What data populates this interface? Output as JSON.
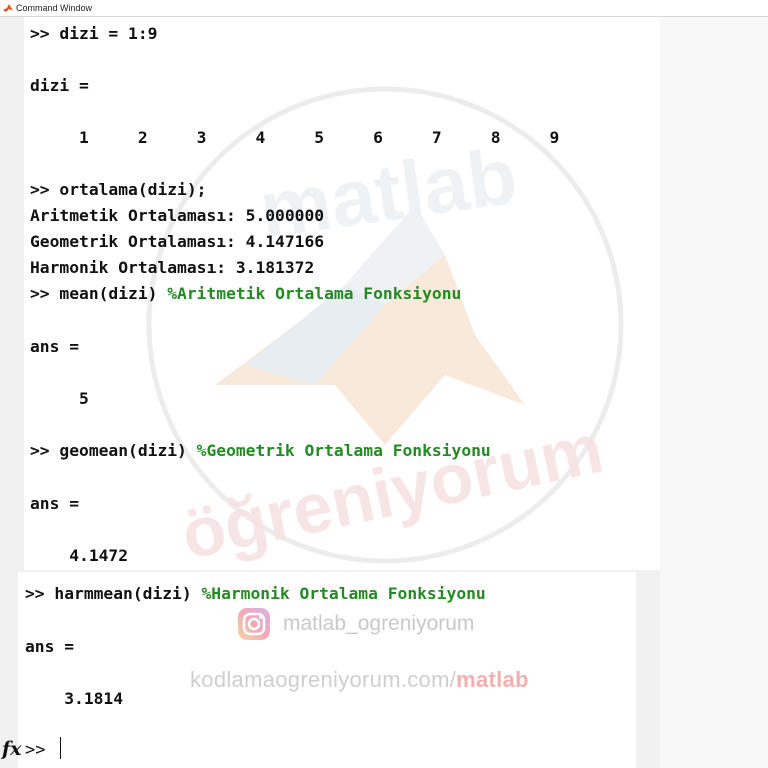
{
  "window": {
    "title": "Command Window"
  },
  "console": {
    "lines": [
      {
        "id": "cmd1",
        "prompt": ">> ",
        "code": "dizi = 1:9",
        "comment": ""
      },
      {
        "id": "out1",
        "text": "dizi ="
      },
      {
        "id": "out2",
        "text": "     1     2     3     4     5     6     7     8     9"
      },
      {
        "id": "cmd2",
        "prompt": ">> ",
        "code": "ortalama(dizi);",
        "comment": ""
      },
      {
        "id": "out3",
        "text": "Aritmetik Ortalaması: 5.000000"
      },
      {
        "id": "out4",
        "text": "Geometrik Ortalaması: 4.147166"
      },
      {
        "id": "out5",
        "text": "Harmonik Ortalaması: 3.181372"
      },
      {
        "id": "cmd3",
        "prompt": ">> ",
        "code": "mean(dizi) ",
        "comment": "%Aritmetik Ortalama Fonksiyonu"
      },
      {
        "id": "out6",
        "text": "ans ="
      },
      {
        "id": "out7",
        "text": "     5"
      },
      {
        "id": "cmd4",
        "prompt": ">> ",
        "code": "geomean(dizi) ",
        "comment": "%Geometrik Ortalama Fonksiyonu"
      },
      {
        "id": "out8",
        "text": "ans ="
      },
      {
        "id": "out9",
        "text": "    4.1472"
      },
      {
        "id": "cmd5",
        "prompt": ">> ",
        "code": "harmmean(dizi) ",
        "comment": "%Harmonik Ortalama Fonksiyonu"
      },
      {
        "id": "out10",
        "text": "ans ="
      },
      {
        "id": "out11",
        "text": "    3.1814"
      }
    ],
    "current_prompt": ">>",
    "fx_label": "fx"
  },
  "watermark": {
    "logo_text_top": "matlab",
    "logo_text_bottom": "öğreniyorum",
    "instagram": "matlab_ogreniyorum",
    "url_main": "kodlamaogreniyorum.com/",
    "url_accent": "matlab"
  },
  "colors": {
    "comment": "#228b22",
    "accent": "#f3b0b0"
  }
}
